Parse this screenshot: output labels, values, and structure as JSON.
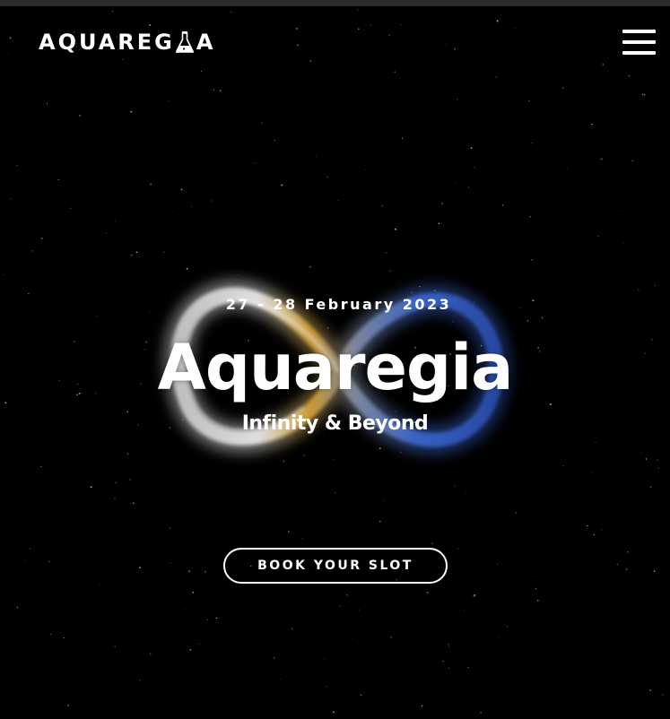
{
  "header": {
    "logo_text_left": "AQUAREG",
    "logo_text_right": "A",
    "logo_icon": "flask-icon",
    "menu_icon": "hamburger-menu-icon"
  },
  "hero": {
    "date": "27 - 28 February 2023",
    "title": "Aquaregia",
    "subtitle": "Infinity & Beyond",
    "cta_label": "BOOK YOUR SLOT",
    "graphic": "infinity-icon"
  },
  "colors": {
    "background": "#000000",
    "top_bar": "#2b2b2b",
    "text": "#ffffff",
    "infinity_gold": "#d9a63a",
    "infinity_silver": "#e0e0e0",
    "infinity_blue": "#3f6bd6"
  }
}
